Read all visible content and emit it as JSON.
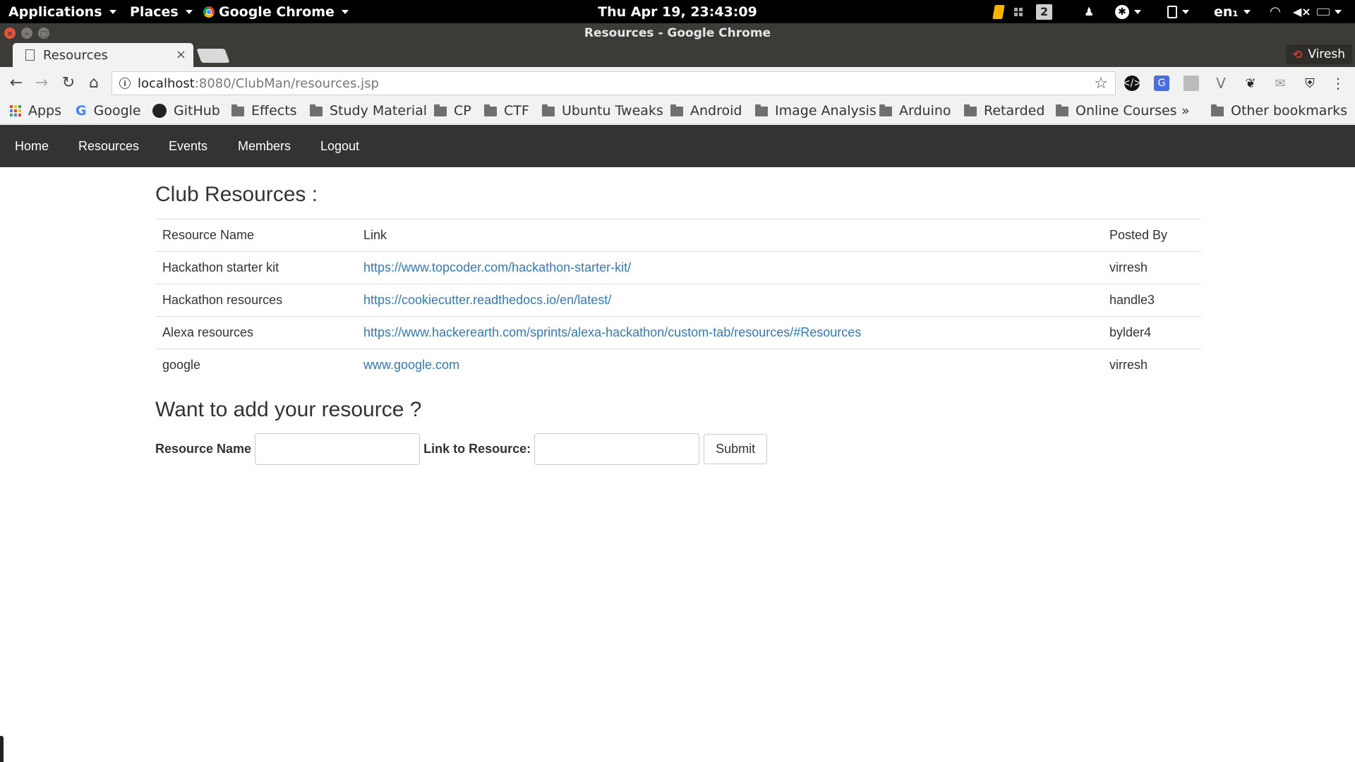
{
  "gnome_panel": {
    "applications": "Applications",
    "places": "Places",
    "active_app": "Google Chrome",
    "clock": "Thu Apr 19, 23:43:09",
    "workspace": "2",
    "keyboard_layout": "en₁"
  },
  "window": {
    "title": "Resources - Google Chrome",
    "profile_name": "Viresh"
  },
  "tab": {
    "title": "Resources"
  },
  "address_bar": {
    "host": "localhost",
    "rest": ":8080/ClubMan/resources.jsp"
  },
  "bookmarks": [
    {
      "label": "Apps",
      "icon": "apps-grid-icon"
    },
    {
      "label": "Google",
      "icon": "google-icon"
    },
    {
      "label": "GitHub",
      "icon": "github-icon"
    },
    {
      "label": "Effects",
      "icon": "folder-icon"
    },
    {
      "label": "Study Material",
      "icon": "folder-icon"
    },
    {
      "label": "CP",
      "icon": "folder-icon"
    },
    {
      "label": "CTF",
      "icon": "folder-icon"
    },
    {
      "label": "Ubuntu Tweaks",
      "icon": "folder-icon"
    },
    {
      "label": "Android",
      "icon": "folder-icon"
    },
    {
      "label": "Image Analysis",
      "icon": "folder-icon"
    },
    {
      "label": "Arduino",
      "icon": "folder-icon"
    },
    {
      "label": "Retarded",
      "icon": "folder-icon"
    },
    {
      "label": "Online Courses",
      "icon": "folder-icon"
    }
  ],
  "bookmarks_overflow": "»",
  "other_bookmarks": "Other bookmarks",
  "navbar": {
    "items": [
      "Home",
      "Resources",
      "Events",
      "Members",
      "Logout"
    ]
  },
  "main": {
    "title": "Club Resources :",
    "table": {
      "headers": [
        "Resource Name",
        "Link",
        "Posted By"
      ],
      "rows": [
        [
          "Hackathon starter kit",
          "https://www.topcoder.com/hackathon-starter-kit/",
          "virresh"
        ],
        [
          "Hackathon resources",
          "https://cookiecutter.readthedocs.io/en/latest/",
          "handle3"
        ],
        [
          "Alexa resources",
          "https://www.hackerearth.com/sprints/alexa-hackathon/custom-tab/resources/#Resources",
          "bylder4"
        ],
        [
          "google",
          "www.google.com",
          "virresh"
        ]
      ]
    },
    "add_title": "Want to add your resource ?",
    "form": {
      "name_label": "Resource Name",
      "link_label": "Link to Resource:",
      "submit_label": "Submit"
    }
  },
  "colors": {
    "navbar_bg": "#333333",
    "link": "#337ab7",
    "chrome_frame": "#3c3b37"
  }
}
